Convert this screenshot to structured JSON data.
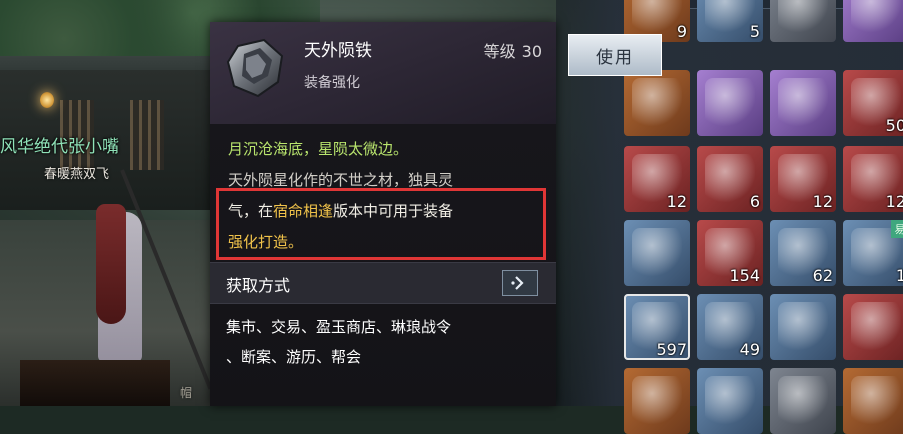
{
  "scene": {
    "player_name": "风华绝代张小嘴",
    "player_title": "春暖燕双飞",
    "stall_text": "帽"
  },
  "tooltip": {
    "item_name": "天外陨铁",
    "level_label": "等级",
    "level_value": "30",
    "item_type": "装备强化",
    "desc_line1": "月沉沧海底，星陨太微边。",
    "desc_line2": "天外陨星化作的不世之材，独具灵",
    "desc_line3_a": "气，在",
    "desc_line3_b": "宿命相逢",
    "desc_line3_c": "版本中可用于装备",
    "desc_line4": "强化打造。",
    "acquire_title": "获取方式",
    "acquire_line1": "集市、交易、盈玉商店、琳琅战令",
    "acquire_line2": "、断案、游历、帮会"
  },
  "use_button": {
    "label": "使用"
  },
  "inventory": {
    "rows": [
      [
        {
          "count": "9",
          "quality": "orange",
          "icon": "scroll-icon"
        },
        {
          "count": "5",
          "quality": "blue",
          "icon": "bottle-icon"
        },
        {
          "count": "",
          "quality": "grey",
          "icon": "tool-icon"
        },
        {
          "count": "",
          "quality": "purple",
          "icon": "gem-icon"
        }
      ],
      [
        {
          "count": "",
          "quality": "orange",
          "icon": "map-icon"
        },
        {
          "count": "",
          "quality": "purple",
          "icon": "brush-icon"
        },
        {
          "count": "",
          "quality": "purple",
          "icon": "ticket-icon"
        },
        {
          "count": "50",
          "quality": "red",
          "icon": "pouch-icon"
        }
      ],
      [
        {
          "count": "12",
          "quality": "red",
          "icon": "gourd-icon"
        },
        {
          "count": "6",
          "quality": "red",
          "icon": "charm-icon"
        },
        {
          "count": "12",
          "quality": "red",
          "icon": "gourd-icon"
        },
        {
          "count": "12",
          "quality": "red",
          "icon": "gourd-icon"
        }
      ],
      [
        {
          "count": "",
          "quality": "blue",
          "icon": "branch-icon"
        },
        {
          "count": "154",
          "quality": "red",
          "icon": "card-icon"
        },
        {
          "count": "62",
          "quality": "blue",
          "icon": "pill-icon"
        },
        {
          "count": "1",
          "quality": "blue",
          "icon": "pill-icon",
          "corner": "易"
        }
      ],
      [
        {
          "count": "597",
          "quality": "blue",
          "icon": "meteorite-icon",
          "selected": true
        },
        {
          "count": "49",
          "quality": "blue",
          "icon": "ore-icon"
        },
        {
          "count": "",
          "quality": "blue",
          "icon": "flower-icon"
        },
        {
          "count": "",
          "quality": "red",
          "icon": "emblem-icon"
        }
      ],
      [
        {
          "count": "",
          "quality": "orange",
          "icon": "box-icon"
        },
        {
          "count": "",
          "quality": "blue",
          "icon": "bone-icon"
        },
        {
          "count": "",
          "quality": "grey",
          "icon": "tool-icon"
        },
        {
          "count": "",
          "quality": "orange",
          "icon": "book-icon"
        }
      ]
    ]
  }
}
